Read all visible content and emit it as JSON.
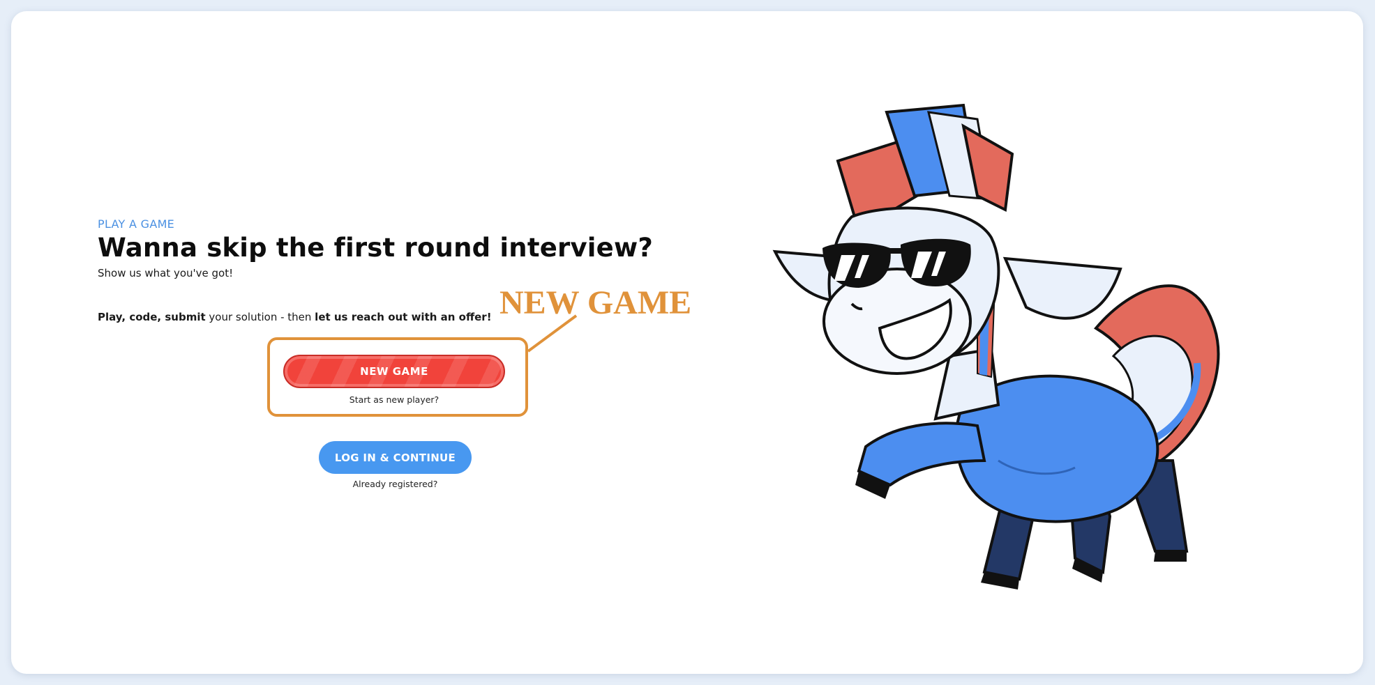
{
  "hero": {
    "eyebrow": "PLAY A GAME",
    "headline": "Wanna skip the first round interview?",
    "subhead": "Show us what you've got!",
    "pitch": {
      "part1_bold": "Play, code, submit",
      "part2": " your solution - then ",
      "part3_bold": "let us reach out with an offer!"
    }
  },
  "actions": {
    "new_game_label": "NEW GAME",
    "new_game_caption": "Start as new player?",
    "login_label": "LOG IN & CONTINUE",
    "login_caption": "Already registered?"
  },
  "annotation": {
    "label": "NEW GAME",
    "color": "#e0923a"
  },
  "mascot": {
    "icon": "zebra-mascot-illustration",
    "colors": {
      "body_blue": "#4c8ef0",
      "leg_navy": "#233866",
      "mane_red": "#e36a5c",
      "fur_white": "#eaf1fb"
    }
  },
  "theme": {
    "accent_blue": "#4898f0",
    "primary_red": "#f1433b",
    "page_bg": "#e6eef8"
  }
}
